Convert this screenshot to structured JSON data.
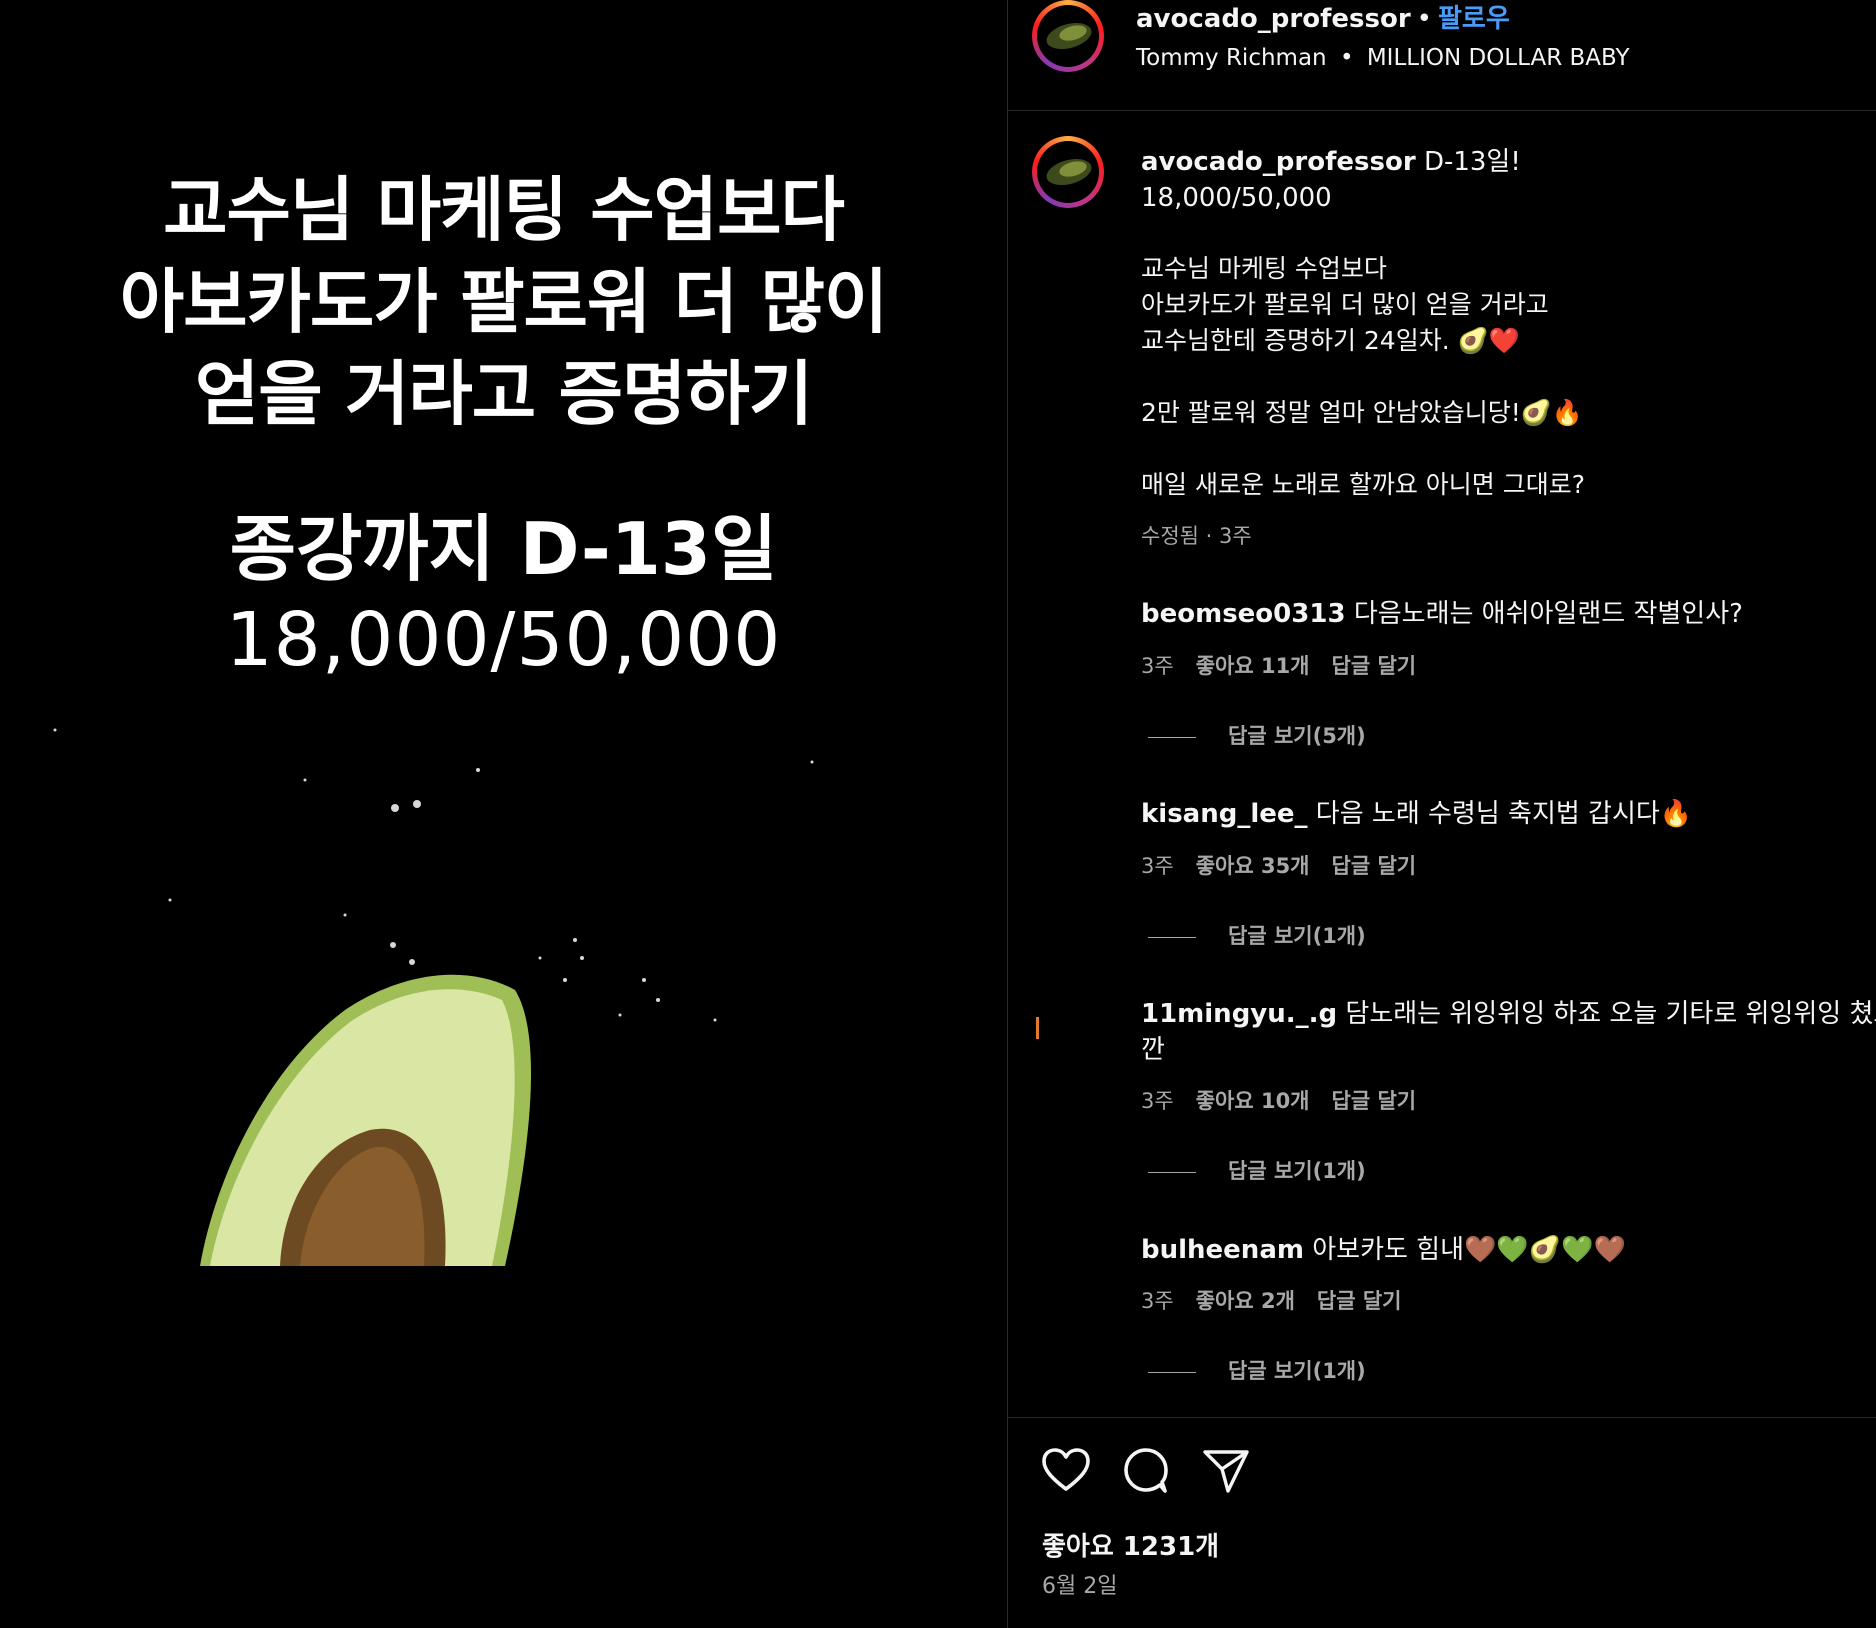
{
  "overlay": {
    "line1": "교수님 마케팅 수업보다",
    "line2": "아보카도가 팔로워 더 많이",
    "line3": "얻을 거라고 증명하기",
    "dday": "종강까지 D-13일",
    "count": "18,000/50,000"
  },
  "header": {
    "username": "avocado_professor",
    "separator": "•",
    "follow": "팔로우",
    "artist": "Tommy Richman",
    "music_sep": "•",
    "song": "MILLION DOLLAR BABY"
  },
  "caption": {
    "username": "avocado_professor",
    "title": "D-13일!",
    "counts": "18,000/50,000",
    "line1": "교수님 마케팅 수업보다",
    "line2": "아보카도가 팔로워 더 많이 얻을 거라고",
    "line3": "교수님한테 증명하기 24일차. 🥑❤️",
    "line4": "2만 팔로워 정말 얼마 안남았습니당!🥑🔥",
    "line5": "매일 새로운 노래로 할까요 아니면 그대로?",
    "meta": "수정됨 · 3주"
  },
  "comments": [
    {
      "user": "beomseo0313",
      "text": "다음노래는 애쉬아일랜드 작별인사?",
      "text2": "",
      "time": "3주",
      "likes": "좋아요 11개",
      "reply": "답글 달기",
      "view": "답글 보기(5개)"
    },
    {
      "user": "kisang_lee_",
      "text": "다음 노래 수령님 축지법 갑시다🔥",
      "text2": "",
      "time": "3주",
      "likes": "좋아요 35개",
      "reply": "답글 달기",
      "view": "답글 보기(1개)"
    },
    {
      "user": "11mingyu._.g",
      "text": "담노래는 위잉위잉 하죠 오늘 기타로 위잉위잉 쳤으",
      "text2": "깐",
      "time": "3주",
      "likes": "좋아요 10개",
      "reply": "답글 달기",
      "view": "답글 보기(1개)"
    },
    {
      "user": "bulheenam",
      "text": "아보카도 힘내🤎💚🥑💚🤎",
      "text2": "",
      "time": "3주",
      "likes": "좋아요 2개",
      "reply": "답글 달기",
      "view": "답글 보기(1개)"
    }
  ],
  "footer": {
    "likes": "좋아요 1231개",
    "date": "6월 2일"
  },
  "icons": [
    "heart-icon",
    "comment-icon",
    "share-icon"
  ]
}
